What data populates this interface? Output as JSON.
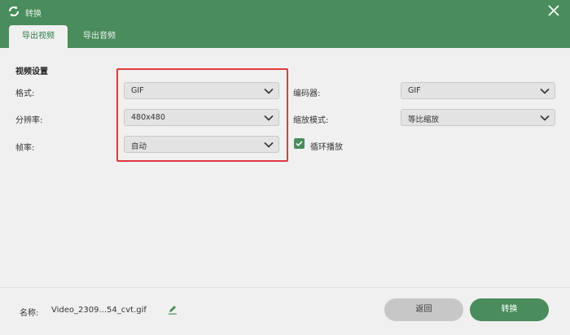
{
  "window": {
    "title": "转换",
    "icons": {
      "app": "refresh-icon",
      "close": "close-icon"
    },
    "accent_color": "#4a8c5c"
  },
  "tabs": [
    {
      "label": "导出视频",
      "active": true
    },
    {
      "label": "导出音频",
      "active": false
    }
  ],
  "video_settings": {
    "section_title": "视频设置",
    "format": {
      "label": "格式:",
      "value": "GIF"
    },
    "resolution": {
      "label": "分辨率:",
      "value": "480x480"
    },
    "frame_rate": {
      "label": "帧率:",
      "value": "自动"
    },
    "encoder": {
      "label": "编码器:",
      "value": "GIF"
    },
    "zoom_mode": {
      "label": "缩放模式:",
      "value": "等比缩放"
    },
    "loop": {
      "label": "循环播放",
      "checked": true
    }
  },
  "footer": {
    "name_label": "名称:",
    "file_name": "Video_2309...54_cvt.gif",
    "back_label": "返回",
    "convert_label": "转换"
  }
}
